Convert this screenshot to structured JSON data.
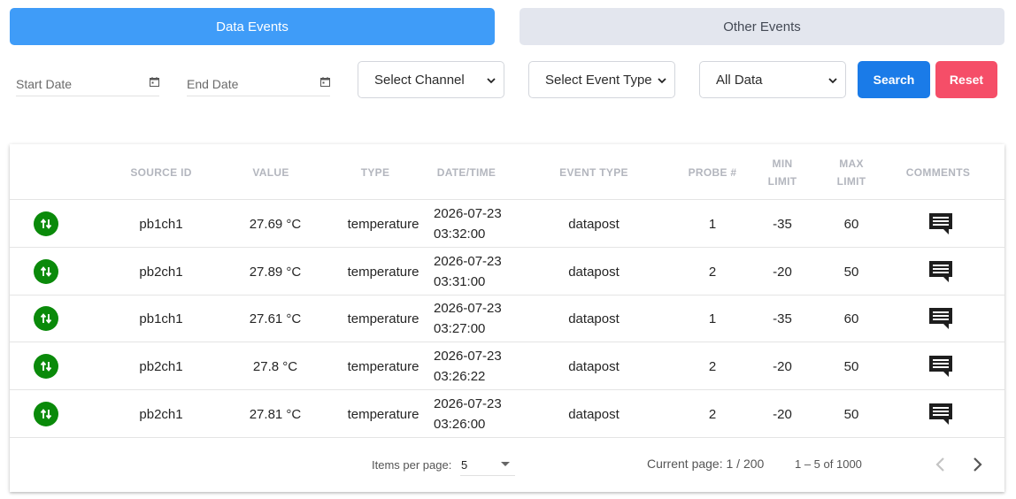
{
  "tabs": {
    "data_events": "Data Events",
    "other_events": "Other Events"
  },
  "filters": {
    "start_date": "Start Date",
    "end_date": "End Date",
    "channel": "Select Channel",
    "event_type": "Select Event Type",
    "data_filter": "All Data",
    "search_label": "Search",
    "reset_label": "Reset"
  },
  "colors": {
    "accent_blue": "#3f9cf8",
    "search_blue": "#1a7be8",
    "reset_red": "#f54e68",
    "status_green": "#0a8a0a"
  },
  "table": {
    "headers": {
      "source_id": "SOURCE ID",
      "value": "VALUE",
      "type": "TYPE",
      "datetime": "DATE/TIME",
      "event_type": "EVENT TYPE",
      "probe": "PROBE #",
      "min_limit_1": "MIN",
      "min_limit_2": "LIMIT",
      "max_limit_1": "MAX",
      "max_limit_2": "LIMIT",
      "comments": "COMMENTS"
    },
    "status_icon": "data-transfer-arrows-icon",
    "comment_icon": "comment-icon",
    "rows": [
      {
        "source_id": "pb1ch1",
        "value": "27.69 °C",
        "type": "temperature",
        "date": "2026-07-23",
        "time": "03:32:00",
        "event_type": "datapost",
        "probe": "1",
        "min_limit": "-35",
        "max_limit": "60"
      },
      {
        "source_id": "pb2ch1",
        "value": "27.89 °C",
        "type": "temperature",
        "date": "2026-07-23",
        "time": "03:31:00",
        "event_type": "datapost",
        "probe": "2",
        "min_limit": "-20",
        "max_limit": "50"
      },
      {
        "source_id": "pb1ch1",
        "value": "27.61 °C",
        "type": "temperature",
        "date": "2026-07-23",
        "time": "03:27:00",
        "event_type": "datapost",
        "probe": "1",
        "min_limit": "-35",
        "max_limit": "60"
      },
      {
        "source_id": "pb2ch1",
        "value": "27.8 °C",
        "type": "temperature",
        "date": "2026-07-23",
        "time": "03:26:22",
        "event_type": "datapost",
        "probe": "2",
        "min_limit": "-20",
        "max_limit": "50"
      },
      {
        "source_id": "pb2ch1",
        "value": "27.81 °C",
        "type": "temperature",
        "date": "2026-07-23",
        "time": "03:26:00",
        "event_type": "datapost",
        "probe": "2",
        "min_limit": "-20",
        "max_limit": "50"
      }
    ]
  },
  "paginator": {
    "items_per_page_label": "Items per page:",
    "items_per_page_value": "5",
    "current_page": "Current page: 1 / 200",
    "range": "1 – 5 of 1000"
  }
}
